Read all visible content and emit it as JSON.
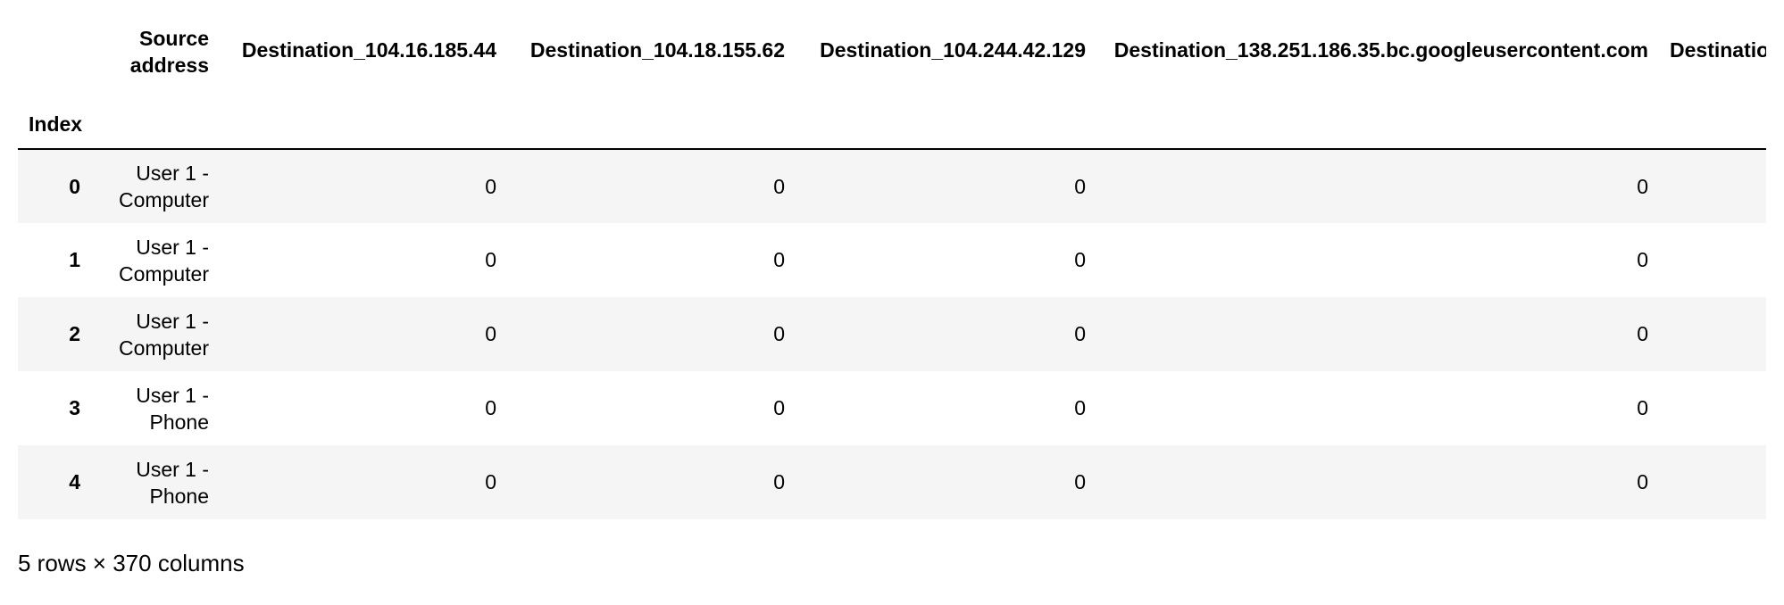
{
  "table": {
    "index_name": "Index",
    "columns": [
      "Source address",
      "Destination_104.16.185.44",
      "Destination_104.18.155.62",
      "Destination_104.244.42.129",
      "Destination_138.251.186.35.bc.googleusercontent.com",
      "Destinatio"
    ],
    "rows": [
      {
        "index": "0",
        "source": "User 1 - Computer",
        "values": [
          "0",
          "0",
          "0",
          "0",
          ""
        ]
      },
      {
        "index": "1",
        "source": "User 1 - Computer",
        "values": [
          "0",
          "0",
          "0",
          "0",
          ""
        ]
      },
      {
        "index": "2",
        "source": "User 1 - Computer",
        "values": [
          "0",
          "0",
          "0",
          "0",
          ""
        ]
      },
      {
        "index": "3",
        "source": "User 1 - Phone",
        "values": [
          "0",
          "0",
          "0",
          "0",
          ""
        ]
      },
      {
        "index": "4",
        "source": "User 1 - Phone",
        "values": [
          "0",
          "0",
          "0",
          "0",
          ""
        ]
      }
    ]
  },
  "footer": {
    "shape_text": "5 rows × 370 columns"
  }
}
